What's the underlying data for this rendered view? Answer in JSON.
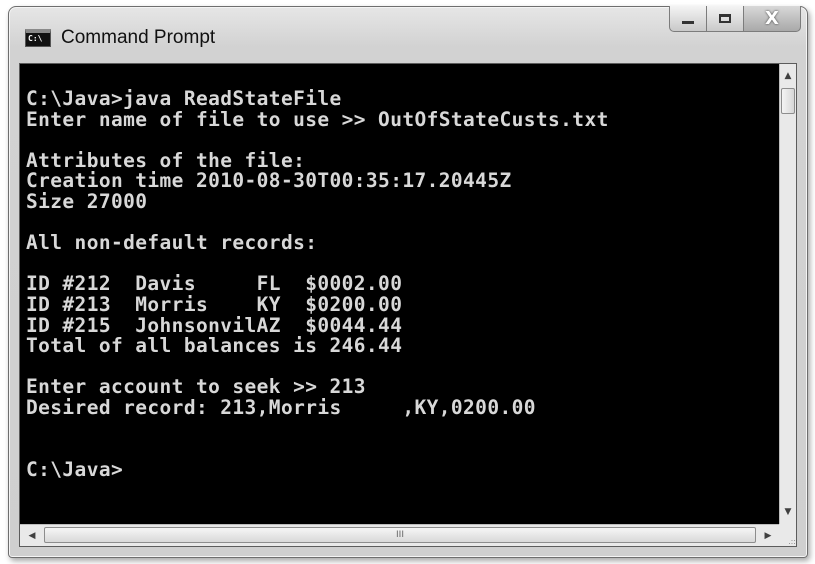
{
  "window": {
    "title": "Command Prompt",
    "icon_label": "C:\\",
    "icons": {
      "app": "command-prompt-icon",
      "minimize": "minimize-icon",
      "maximize": "maximize-icon",
      "close": "close-icon"
    },
    "close_glyph": "X"
  },
  "console": {
    "background_color": "#000000",
    "text_color": "#d8d8d8",
    "text": "C:\\Java>java ReadStateFile\nEnter name of file to use >> OutOfStateCusts.txt\n\nAttributes of the file:\nCreation time 2010-08-30T00:35:17.20445Z\nSize 27000\n\nAll non-default records:\n\nID #212  Davis     FL  $0002.00\nID #213  Morris    KY  $0200.00\nID #215  JohnsonvilAZ  $0044.44\nTotal of all balances is 246.44\n\nEnter account to seek >> 213\nDesired record: 213,Morris     ,KY,0200.00\n\n\nC:\\Java>"
  },
  "scrollbars": {
    "vertical": {
      "up_arrow": "▲",
      "down_arrow": "▼"
    },
    "horizontal": {
      "left_arrow": "◀",
      "right_arrow": "▶",
      "thumb_grip": "III"
    },
    "resize_grip": ".::"
  }
}
